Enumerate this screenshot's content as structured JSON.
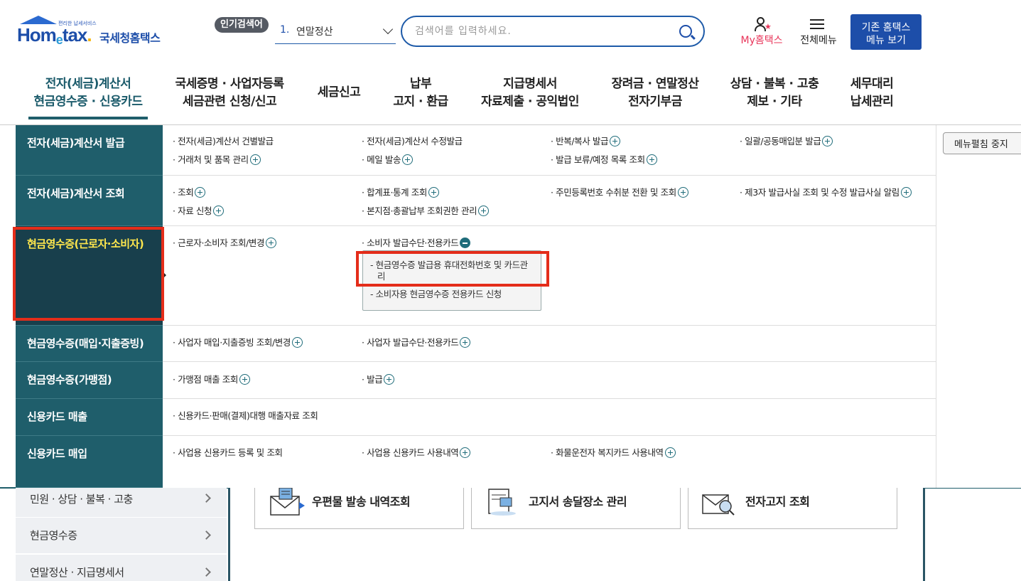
{
  "header": {
    "logo_small": "편리한 납세서비스",
    "logo_main": [
      "Hom",
      "e",
      "tax",
      "."
    ],
    "logo_sub": "국세청홈택스",
    "popular_badge": "인기검색어",
    "popular_num": "1.",
    "popular_keyword": "연말정산",
    "search_placeholder": "검색어를 입력하세요.",
    "my_hometax": "My홈택스",
    "all_menu": "전체메뉴",
    "old_menu_line1": "기존 홈택스",
    "old_menu_line2": "메뉴 보기"
  },
  "gnb": [
    {
      "line1": "전자(세금)계산서",
      "line2": "현금영수증 · 신용카드"
    },
    {
      "line1": "국세증명 · 사업자등록",
      "line2": "세금관련 신청/신고"
    },
    {
      "line1": "세금신고",
      "line2": ""
    },
    {
      "line1": "납부",
      "line2": "고지 · 환급"
    },
    {
      "line1": "지급명세서",
      "line2": "자료제출 · 공익법인"
    },
    {
      "line1": "장려금 · 연말정산",
      "line2": "전자기부금"
    },
    {
      "line1": "상담 · 불복 · 고충",
      "line2": "제보 · 기타"
    },
    {
      "line1": "세무대리",
      "line2": "납세관리"
    }
  ],
  "categories": [
    "전자(세금)계산서 발급",
    "전자(세금)계산서 조회",
    "현금영수증(근로자·소비자)",
    "현금영수증(매입·지출증빙)",
    "현금영수증(가맹점)",
    "신용카드 매출",
    "신용카드 매입"
  ],
  "links": {
    "r0": [
      "· 전자(세금)계산서 건별발급",
      "· 전자(세금)계산서 수정발급",
      "· 반복/복사 발급",
      "· 일괄/공동매입분 발급",
      "· 거래처 및 품목 관리",
      "· 메일 발송",
      "· 발급 보류/예정 목록 조회"
    ],
    "r1": [
      "· 조회",
      "· 합계표·통계 조회",
      "· 주민등록번호 수취분 전환 및 조회",
      "· 제3자 발급사실 조회 및 수정 발급사실 알림",
      "· 자료 신청",
      "· 본지점·총괄납부 조회권한 관리"
    ],
    "r2": [
      "· 근로자·소비자 조회/변경",
      "· 소비자 발급수단·전용카드"
    ],
    "r3": [
      "· 사업자 매입·지출증빙 조회/변경",
      "· 사업자 발급수단·전용카드"
    ],
    "r4": [
      "· 가맹점 매출 조회",
      "· 발급"
    ],
    "r5": [
      "· 신용카드·판매(결제)대행 매출자료 조회"
    ],
    "r6": [
      "· 사업용 신용카드 등록 및 조회",
      "· 사업용 신용카드 사용내역",
      "· 화물운전자 복지카드 사용내역"
    ]
  },
  "submenu": {
    "item1_line1": "- 현금영수증 발급용 휴대전화번호 및 카드관",
    "item1_line2": "리",
    "item2": "- 소비자용 현금영수증 전용카드 신청"
  },
  "stop_button": "메뉴펼침 중지",
  "background": {
    "side": [
      "민원 · 상담 · 불복 · 고충",
      "현금영수증",
      "연말정산 · 지급명세서"
    ],
    "cards": [
      "우편물 발송 내역조회",
      "고지서 송달장소 관리",
      "전자고지 조회"
    ]
  },
  "colors": {
    "brand": "#1d4ea9",
    "menu_teal": "#1f5e6b",
    "highlight": "#e42d1a",
    "active_text": "#ffe74d"
  }
}
